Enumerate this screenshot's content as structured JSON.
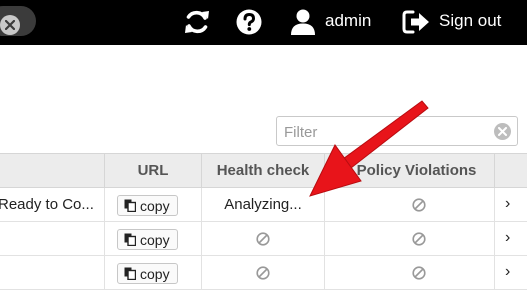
{
  "topbar": {
    "close_icon": "close-icon",
    "refresh_icon": "refresh-icon",
    "help_icon": "question-circle-icon",
    "user_icon": "user-icon",
    "username": "admin",
    "signout_icon": "sign-out-icon",
    "signout_label": "Sign out"
  },
  "filter": {
    "placeholder": "Filter",
    "value": ""
  },
  "table": {
    "columns": [
      "URL",
      "Health check",
      "Policy Violations"
    ],
    "rows": [
      {
        "status": "Ready to Co...",
        "url_action": "copy",
        "health": "Analyzing...",
        "policy": "not-available-icon"
      },
      {
        "status": "",
        "url_action": "copy",
        "health": "not-available-icon",
        "policy": "not-available-icon"
      },
      {
        "status": "",
        "url_action": "copy",
        "health": "not-available-icon",
        "policy": "not-available-icon"
      }
    ],
    "row_action_glyph": "›"
  },
  "annotation": {
    "type": "red-arrow",
    "color": "#e8141a"
  },
  "colors": {
    "topbar": "#000000",
    "header": "#ececec",
    "accent_arrow": "#e8141a"
  }
}
